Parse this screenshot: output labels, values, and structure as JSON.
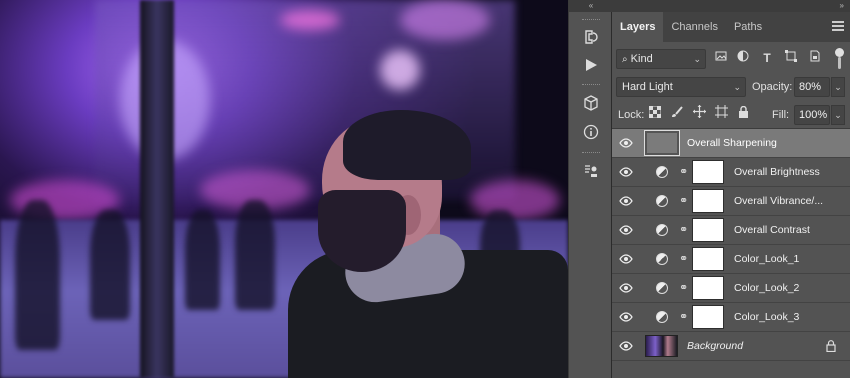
{
  "iconbar": {
    "collapse_glyph": "«",
    "icons": [
      "history-icon",
      "play-action-icon",
      "3d-icon",
      "info-icon",
      "clone-source-icon"
    ]
  },
  "panel": {
    "collapse_glyph": "»",
    "tabs": [
      {
        "label": "Layers",
        "active": true
      },
      {
        "label": "Channels",
        "active": false
      },
      {
        "label": "Paths",
        "active": false
      }
    ],
    "filter": {
      "kind_label": "Kind"
    },
    "blend_mode": "Hard Light",
    "opacity_label": "Opacity:",
    "opacity_value": "80%",
    "lock_label": "Lock:",
    "fill_label": "Fill:",
    "fill_value": "100%"
  },
  "layers": [
    {
      "name": "Overall Sharpening",
      "type": "smart",
      "selected": true
    },
    {
      "name": "Overall Brightness",
      "type": "adjustment"
    },
    {
      "name": "Overall Vibrance/...",
      "type": "adjustment"
    },
    {
      "name": "Overall Contrast",
      "type": "adjustment"
    },
    {
      "name": "Color_Look_1",
      "type": "adjustment"
    },
    {
      "name": "Color_Look_2",
      "type": "adjustment"
    },
    {
      "name": "Color_Look_3",
      "type": "adjustment"
    },
    {
      "name": "Background",
      "type": "background",
      "locked": true
    }
  ]
}
